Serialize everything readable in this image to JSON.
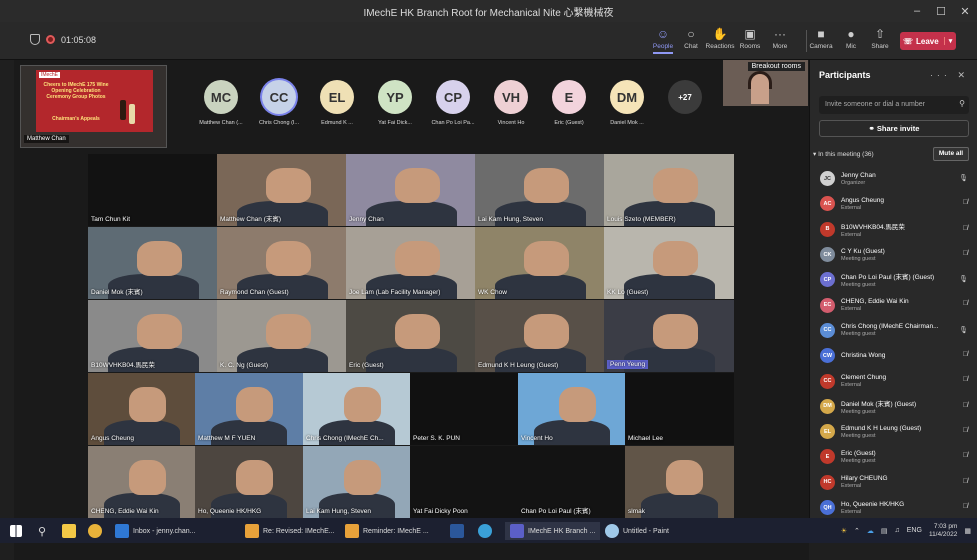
{
  "window": {
    "title": "IMechE HK Branch Root for Mechanical Nite 心繫機械夜",
    "minimize": "–",
    "maximize": "☐",
    "close": "✕"
  },
  "toolbar": {
    "timer": "01:05:08",
    "people": "People",
    "chat": "Chat",
    "reactions": "Reactions",
    "rooms": "Rooms",
    "more": "More",
    "camera": "Camera",
    "mic": "Mic",
    "share": "Share",
    "leave": "Leave"
  },
  "featured": {
    "name": "Matthew Chan",
    "slide_logo": "IMechE",
    "slide_text": "Cheers to IMechE 175 Wine Opening Celebration Ceremony Group Photos",
    "slide_sub": "Chairman's Appeals",
    "tag": "IMechE"
  },
  "avatar_row": [
    {
      "initials": "MC",
      "name": "Matthew Chan (...",
      "color": "#c9d3bf"
    },
    {
      "initials": "CC",
      "name": "Chris Chong (I...",
      "color": "#c6d2e8"
    },
    {
      "initials": "EL",
      "name": "Edmund K ...",
      "color": "#efe0b5"
    },
    {
      "initials": "YP",
      "name": "Yat Fai Dick...",
      "color": "#cfe3c4"
    },
    {
      "initials": "CP",
      "name": "Chan Po Loi Pa...",
      "color": "#d7d1ec"
    },
    {
      "initials": "VH",
      "name": "Vincent Ho",
      "color": "#eed0d4"
    },
    {
      "initials": "E",
      "name": "Eric (Guest)",
      "color": "#f2d3dc"
    },
    {
      "initials": "DM",
      "name": "Daniel Mok ...",
      "color": "#f5e4b8"
    },
    {
      "initials": "+27",
      "name": "",
      "color": "#3b3b3b"
    }
  ],
  "breakout": {
    "label": "Breakout rooms"
  },
  "tiles": [
    {
      "name": "Tam Chun Kit",
      "bg": "#121212"
    },
    {
      "name": "Matthew Chan (末賓)",
      "bg": "#7a6757"
    },
    {
      "name": "Jenny Chan",
      "bg": "#8f8aa0"
    },
    {
      "name": "Lai Kam Hung, Steven",
      "bg": "#6c6c6c"
    },
    {
      "name": "Louis Szeto (MEMBER)",
      "bg": "#a9a69c"
    },
    {
      "name": "Daniel Mok (末賓)",
      "bg": "#5e6b74"
    },
    {
      "name": "Raymond Chan (Guest)",
      "bg": "#8d7b6c"
    },
    {
      "name": "Joe Lam (Lab Facility Manager)",
      "bg": "#a7a096"
    },
    {
      "name": "WK Chow",
      "bg": "#8f8468"
    },
    {
      "name": "KK Lo (Guest)",
      "bg": "#b9b6ad"
    },
    {
      "name": "B10WVHKB04.馬民荣",
      "bg": "#8a8a8a"
    },
    {
      "name": "K. C. Ng (Guest)",
      "bg": "#9c9891"
    },
    {
      "name": "Eric (Guest)",
      "bg": "#4d4a44"
    },
    {
      "name": "Edmund K H Leung (Guest)",
      "bg": "#585048"
    },
    {
      "name": "Penn Yeung",
      "bg": "#3b3d46"
    },
    {
      "name": "Angus Cheung",
      "bg": "#5e4d3c"
    },
    {
      "name": "Matthew M F YUEN",
      "bg": "#5e7ea6"
    },
    {
      "name": "Chris Chong (IMechE Ch...",
      "bg": "#b6c9d4"
    },
    {
      "name": "Peter S. K. PUN",
      "bg": "#111111"
    },
    {
      "name": "Vincent Ho",
      "bg": "#6ea7d6"
    },
    {
      "name": "Michael Lee",
      "bg": "#111111"
    },
    {
      "name": "CHENG, Eddie Wai Kin",
      "bg": "#8a7f74"
    },
    {
      "name": "Ho, Queenie HK/HKG",
      "bg": "#4d4640"
    },
    {
      "name": "Lai Kam Hung, Steven",
      "bg": "#93a7b7"
    },
    {
      "name": "Yat Fai Dicky Poon",
      "bg": "#131313"
    },
    {
      "name": "Chan Po Loi Paul (末賓)",
      "bg": "#131313"
    },
    {
      "name": "slmak",
      "bg": "#615548"
    }
  ],
  "panel": {
    "title": "Participants",
    "more": "···",
    "close": "✕",
    "invite_placeholder": "Invite someone or dial a number",
    "share_invite": "Share invite",
    "section": "In this meeting (36)",
    "mute_all": "Mute all"
  },
  "participants": [
    {
      "initials": "JC",
      "name": "Jenny Chan",
      "sub": "Organizer",
      "color": "#d0d0d0",
      "mic": "🎙"
    },
    {
      "initials": "AC",
      "name": "Angus Cheung",
      "sub": "External",
      "color": "#d9534f",
      "mic": "🎙̸"
    },
    {
      "initials": "B",
      "name": "B10WVHKB04.馬民荣",
      "sub": "External",
      "color": "#c0392b",
      "mic": "🎙̸"
    },
    {
      "initials": "CK",
      "name": "C Y Ku (Guest)",
      "sub": "Meeting guest",
      "color": "#7f8c9c",
      "mic": "🎙̸"
    },
    {
      "initials": "CP",
      "name": "Chan Po Loi Paul (末賓) (Guest)",
      "sub": "Meeting guest",
      "color": "#6c6fd0",
      "mic": "🎙"
    },
    {
      "initials": "EC",
      "name": "CHENG, Eddie Wai Kin",
      "sub": "External",
      "color": "#d35d6e",
      "mic": "🎙̸"
    },
    {
      "initials": "CC",
      "name": "Chris Chong (IMechE Chairman...",
      "sub": "Meeting guest",
      "color": "#5b8dd6",
      "mic": "🎙"
    },
    {
      "initials": "CW",
      "name": "Christina Wong",
      "sub": "",
      "color": "#4a6fd6",
      "mic": "🎙̸"
    },
    {
      "initials": "CC",
      "name": "Clement Chung",
      "sub": "External",
      "color": "#c0392b",
      "mic": "🎙̸"
    },
    {
      "initials": "DM",
      "name": "Daniel Mok (末賓) (Guest)",
      "sub": "Meeting guest",
      "color": "#d4a84a",
      "mic": "🎙̸"
    },
    {
      "initials": "EL",
      "name": "Edmund K H Leung (Guest)",
      "sub": "Meeting guest",
      "color": "#d4a84a",
      "mic": "🎙̸"
    },
    {
      "initials": "E",
      "name": "Eric (Guest)",
      "sub": "Meeting guest",
      "color": "#c0392b",
      "mic": "🎙̸"
    },
    {
      "initials": "HC",
      "name": "Hilary CHEUNG",
      "sub": "External",
      "color": "#c0392b",
      "mic": "🎙̸"
    },
    {
      "initials": "QH",
      "name": "Ho, Queenie HK/HKG",
      "sub": "External",
      "color": "#4a6fd6",
      "mic": "🎙̸"
    }
  ],
  "taskbar": {
    "inbox": "Inbox - jenny.chan...",
    "re": "Re: Revised: IMechE...",
    "reminder": "Reminder: IMechE ...",
    "teams": "IMechE HK Branch ...",
    "paint": "Untitled - Paint",
    "lang": "ENG",
    "time": "7:03 pm",
    "date": "11/4/2022"
  }
}
